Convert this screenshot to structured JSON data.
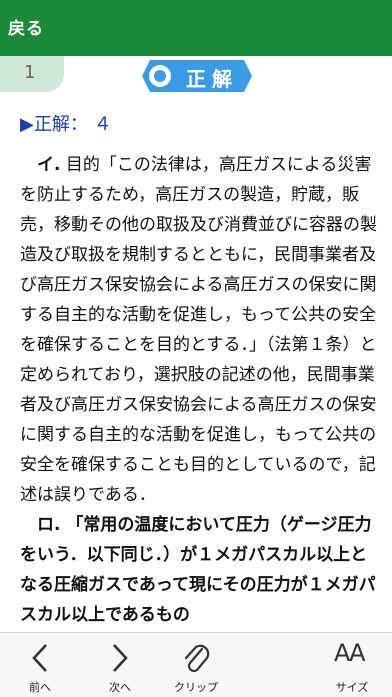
{
  "header": {
    "back_label": "戻る"
  },
  "question": {
    "number": "1",
    "badge_label": "正解"
  },
  "answer": {
    "text": "▶正解： ４"
  },
  "explanation": {
    "para1_marker": "イ.",
    "para1_body": " 目的「この法律は，高圧ガスによる災害を防止するため，高圧ガスの製造，貯蔵，販売，移動その他の取扱及び消費並びに容器の製造及び取扱を規制するとともに，民間事業者及び高圧ガス保安協会による高圧ガスの保安に関する自主的な活動を促進し，もって公共の安全を確保することを目的とする．」（法第１条）と定められており，選択肢の記述の他，民間事業者及び高圧ガス保安協会による高圧ガスの保安に関する自主的な活動を促進し，もって公共の安全を確保することも目的としているので，記述は誤りである．",
    "para2": "ロ. 「常用の温度において圧力（ゲージ圧力をいう．以下同じ．）が１メガパスカル以上となる圧縮ガスであって現にその圧力が１メガパスカル以上であるもの"
  },
  "toolbar": {
    "prev_label": "前へ",
    "next_label": "次へ",
    "clip_label": "クリップ",
    "size_label": "サイズ",
    "size_glyph": "AA"
  },
  "colors": {
    "header": "#1a8a3a",
    "tab": "#cfe7d6",
    "badge": "#3c9be6",
    "answer": "#1d3fa8"
  }
}
